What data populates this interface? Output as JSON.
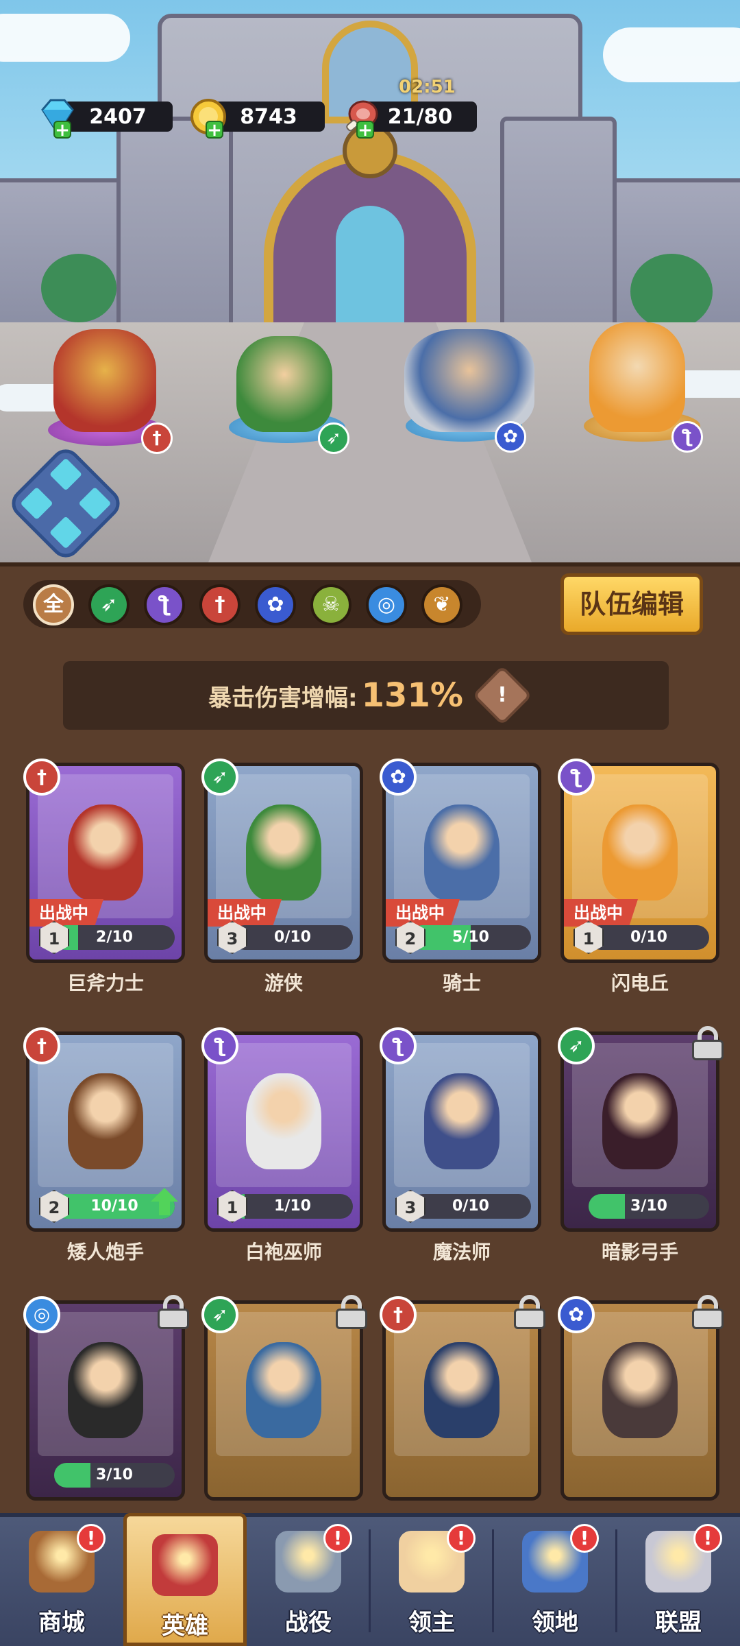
{
  "resources": {
    "gems": "2407",
    "gold": "8743",
    "stamina": "21/80",
    "stamina_timer": "02:51"
  },
  "filters": [
    {
      "label": "全",
      "icon": "all-icon",
      "color": "#c58a52"
    },
    {
      "label": "",
      "icon": "bow-class-icon",
      "color": "#2ea456"
    },
    {
      "label": "",
      "icon": "staff-class-icon",
      "color": "#7a52c9"
    },
    {
      "label": "",
      "icon": "sword-class-icon",
      "color": "#c9453a"
    },
    {
      "label": "",
      "icon": "paw-class-icon",
      "color": "#3a5bd0"
    },
    {
      "label": "",
      "icon": "skull-class-icon",
      "color": "#8ab13c"
    },
    {
      "label": "",
      "icon": "spiral-class-icon",
      "color": "#3a8ce0"
    },
    {
      "label": "",
      "icon": "wings-class-icon",
      "color": "#c8862d"
    }
  ],
  "team_edit_button": "队伍编辑",
  "crit": {
    "label": "暴击伤害增幅:",
    "value": "131%",
    "info_icon": "!"
  },
  "battle_tag": "出战中",
  "heroes": [
    {
      "name": "巨斧力士",
      "level": "1",
      "progress": "2/10",
      "progress_fraction": 0.2,
      "in_battle": true,
      "locked": false,
      "class_icon": "sword-class-icon",
      "class_color": "#c9453a",
      "card_color": "purple"
    },
    {
      "name": "游侠",
      "level": "3",
      "progress": "0/10",
      "progress_fraction": 0,
      "in_battle": true,
      "locked": false,
      "class_icon": "bow-class-icon",
      "class_color": "#2ea456",
      "card_color": "blue"
    },
    {
      "name": "骑士",
      "level": "2",
      "progress": "5/10",
      "progress_fraction": 0.5,
      "in_battle": true,
      "locked": false,
      "class_icon": "paw-class-icon",
      "class_color": "#3a5bd0",
      "card_color": "blue"
    },
    {
      "name": "闪电丘",
      "level": "1",
      "progress": "0/10",
      "progress_fraction": 0,
      "in_battle": true,
      "locked": false,
      "class_icon": "staff-class-icon",
      "class_color": "#7a52c9",
      "card_color": "gold"
    },
    {
      "name": "矮人炮手",
      "level": "2",
      "progress": "10/10",
      "progress_fraction": 1,
      "in_battle": false,
      "locked": false,
      "upgrade": true,
      "class_icon": "sword-class-icon",
      "class_color": "#c9453a",
      "card_color": "blue"
    },
    {
      "name": "白袍巫师",
      "level": "1",
      "progress": "1/10",
      "progress_fraction": 0.1,
      "in_battle": false,
      "locked": false,
      "class_icon": "staff-class-icon",
      "class_color": "#7a52c9",
      "card_color": "purple"
    },
    {
      "name": "魔法师",
      "level": "3",
      "progress": "0/10",
      "progress_fraction": 0,
      "in_battle": false,
      "locked": false,
      "class_icon": "staff-class-icon",
      "class_color": "#7a52c9",
      "card_color": "blue"
    },
    {
      "name": "暗影弓手",
      "level": "",
      "progress": "3/10",
      "progress_fraction": 0.3,
      "in_battle": false,
      "locked": true,
      "class_icon": "bow-class-icon",
      "class_color": "#2ea456",
      "card_color": "dark"
    },
    {
      "name": "",
      "level": "",
      "progress": "3/10",
      "progress_fraction": 0.3,
      "in_battle": false,
      "locked": true,
      "class_icon": "spiral-class-icon",
      "class_color": "#3a8ce0",
      "card_color": "dark"
    },
    {
      "name": "",
      "level": "",
      "progress": "",
      "progress_fraction": 0,
      "in_battle": false,
      "locked": true,
      "class_icon": "bow-class-icon",
      "class_color": "#2ea456",
      "card_color": "brown"
    },
    {
      "name": "",
      "level": "",
      "progress": "",
      "progress_fraction": 0,
      "in_battle": false,
      "locked": true,
      "class_icon": "sword-class-icon",
      "class_color": "#c9453a",
      "card_color": "brown"
    },
    {
      "name": "",
      "level": "",
      "progress": "",
      "progress_fraction": 0,
      "in_battle": false,
      "locked": true,
      "class_icon": "paw-class-icon",
      "class_color": "#3a5bd0",
      "card_color": "brown"
    }
  ],
  "nav": [
    {
      "label": "商城",
      "icon": "shop-icon",
      "alert": "!",
      "active": false
    },
    {
      "label": "英雄",
      "icon": "heroes-icon",
      "alert": "",
      "active": true
    },
    {
      "label": "战役",
      "icon": "battle-icon",
      "alert": "!",
      "active": false
    },
    {
      "label": "领主",
      "icon": "lord-icon",
      "alert": "!",
      "active": false
    },
    {
      "label": "领地",
      "icon": "territory-icon",
      "alert": "!",
      "active": false
    },
    {
      "label": "联盟",
      "icon": "alliance-icon",
      "alert": "!",
      "active": false
    }
  ]
}
